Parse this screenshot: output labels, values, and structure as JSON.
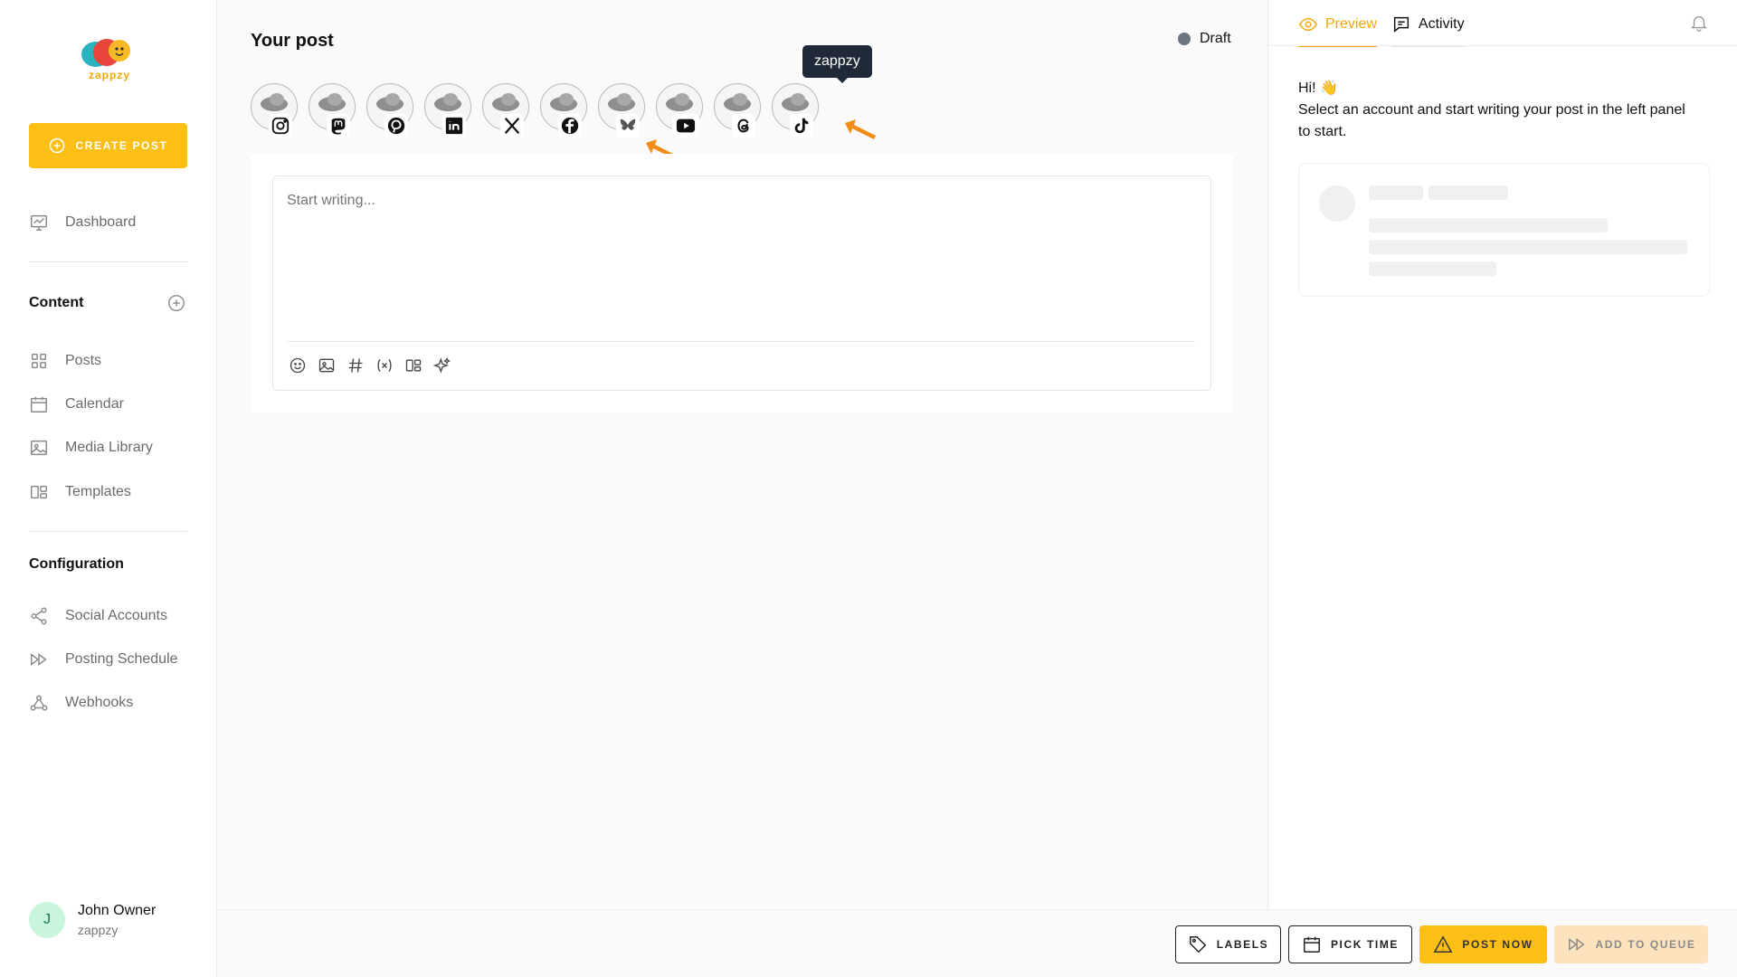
{
  "app": {
    "logo_text": "zappzy"
  },
  "sidebar": {
    "create_label": "CREATE POST",
    "dashboard": "Dashboard",
    "content_title": "Content",
    "content_items": [
      "Posts",
      "Calendar",
      "Media Library",
      "Templates"
    ],
    "config_title": "Configuration",
    "config_items": [
      "Social Accounts",
      "Posting Schedule",
      "Webhooks"
    ],
    "user": {
      "initial": "J",
      "name": "John Owner",
      "org": "zappzy"
    }
  },
  "main": {
    "title": "Your post",
    "status": "Draft",
    "accounts": [
      {
        "network": "instagram-icon"
      },
      {
        "network": "mastodon-icon"
      },
      {
        "network": "pinterest-icon"
      },
      {
        "network": "linkedin-icon"
      },
      {
        "network": "x-icon"
      },
      {
        "network": "facebook-icon"
      },
      {
        "network": "bluesky-icon"
      },
      {
        "network": "youtube-icon"
      },
      {
        "network": "threads-icon"
      },
      {
        "network": "tiktok-icon"
      }
    ],
    "tooltip": "zappzy",
    "editor_placeholder": "Start writing..."
  },
  "right": {
    "tabs": [
      "Preview",
      "Activity"
    ],
    "greeting": "Hi! 👋",
    "message": "Select an account and start writing your post in the left panel to start."
  },
  "bottom": {
    "labels": "LABELS",
    "pick_time": "PICK TIME",
    "post_now": "POST NOW",
    "add_to_queue": "ADD TO QUEUE"
  },
  "colors": {
    "accent": "#fbbf16",
    "arrow": "#f28c18",
    "active_tab": "#f5a70a"
  }
}
